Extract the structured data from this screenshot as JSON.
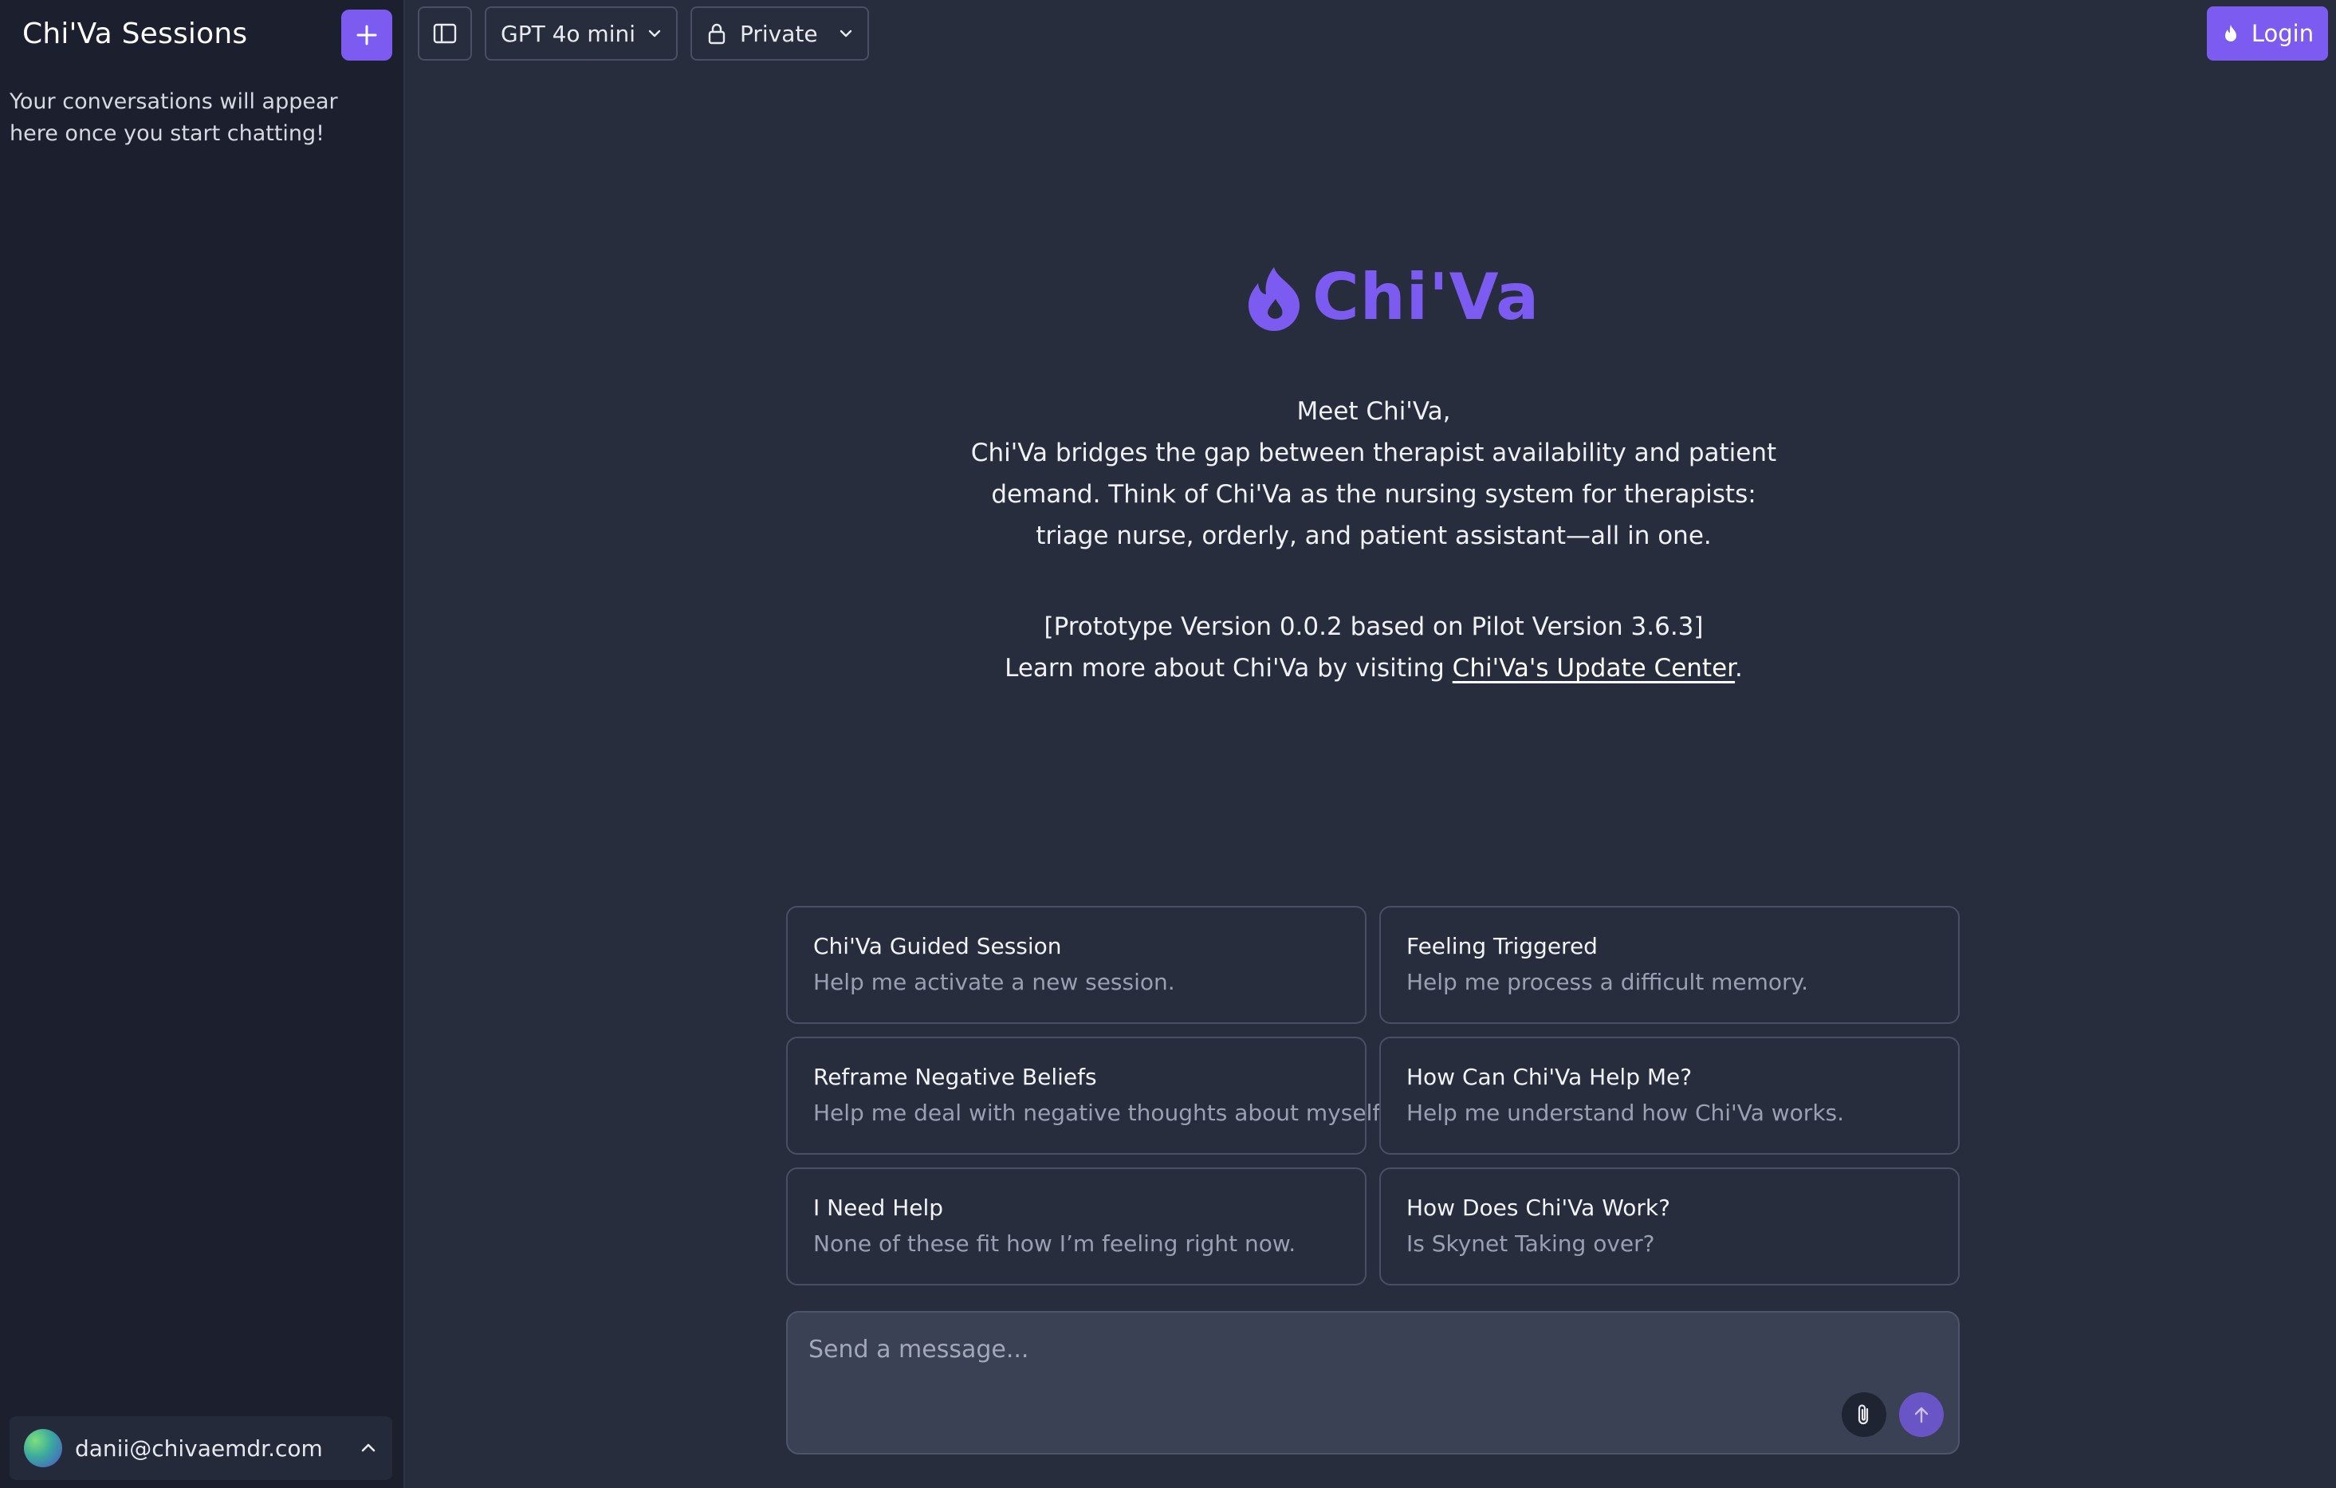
{
  "sidebar": {
    "title": "Chi'Va Sessions",
    "empty_message": "Your conversations will appear here once you start chatting!",
    "new_button_icon": "plus-icon",
    "user": {
      "email": "danii@chivaemdr.com",
      "toggle_icon": "chevron-up-icon"
    }
  },
  "topbar": {
    "sidebar_toggle_icon": "sidebar-panel-icon",
    "model": {
      "selected": "GPT 4o mini",
      "icon": "chevron-down-icon"
    },
    "visibility": {
      "selected": "Private",
      "icon": "lock-icon"
    },
    "login": {
      "label": "Login",
      "icon": "flame-icon"
    }
  },
  "hero": {
    "logo_text": "Chi'Va",
    "intro_line1": "Meet Chi'Va,",
    "intro_body": "Chi'Va bridges the gap between therapist availability and patient demand. Think of Chi'Va as the nursing system for therapists: triage nurse, orderly, and patient assistant—all in one.",
    "version": "[Prototype Version 0.0.2 based on Pilot Version 3.6.3]",
    "learn_prefix": "Learn more about Chi'Va by visiting ",
    "learn_link": "Chi'Va's Update Center",
    "learn_suffix": "."
  },
  "suggestions": [
    {
      "title": "Chi'Va Guided Session",
      "subtitle": "Help me activate a new session."
    },
    {
      "title": "Feeling Triggered",
      "subtitle": "Help me process a difficult memory."
    },
    {
      "title": "Reframe Negative Beliefs",
      "subtitle": "Help me deal with negative thoughts about myself."
    },
    {
      "title": "How Can Chi'Va Help Me?",
      "subtitle": "Help me understand how Chi'Va works."
    },
    {
      "title": "I Need Help",
      "subtitle": "None of these fit how I’m feeling right now."
    },
    {
      "title": "How Does Chi'Va Work?",
      "subtitle": "Is Skynet Taking over?"
    }
  ],
  "composer": {
    "placeholder": "Send a message...",
    "value": "",
    "attach_icon": "paperclip-icon",
    "send_icon": "arrow-up-icon"
  },
  "colors": {
    "accent": "#7c5cf0",
    "background": "#272d3d",
    "sidebar": "#1b1f2e"
  }
}
